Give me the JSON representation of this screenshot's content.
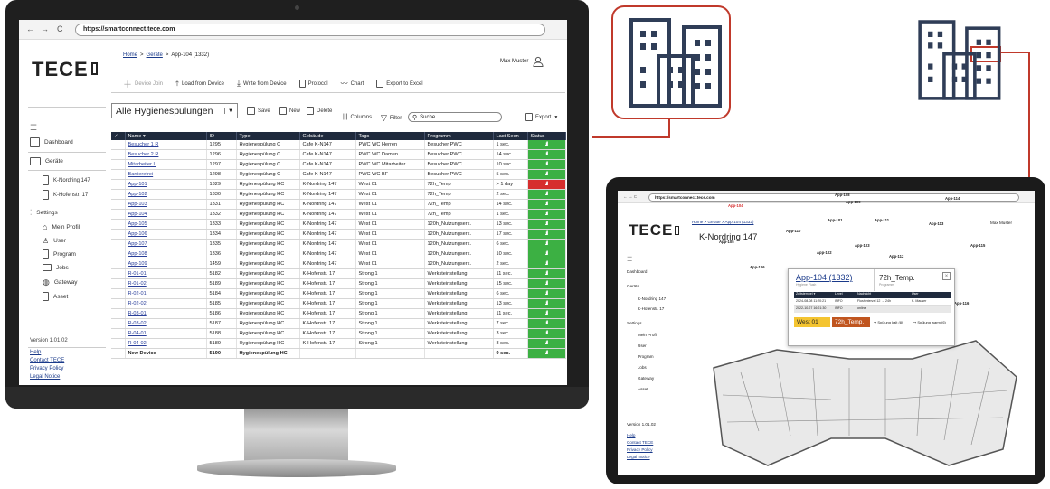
{
  "browser": {
    "url": "https://smartconnect.tece.com",
    "back": "←",
    "forward": "→",
    "reload": "C"
  },
  "brand": {
    "logo": "TECE",
    "accent": "#c0392b",
    "navy": "#1f2a3d",
    "good": "#3cb043",
    "bad": "#d62e2e"
  },
  "breadcrumb": {
    "home": "Home",
    "sep1": ">",
    "devices": "Geräte",
    "sep2": ">",
    "current": "App-104 (1332)"
  },
  "user": {
    "name": "Max Muster"
  },
  "sidebar": {
    "dashboard": "Dashboard",
    "devices": "Geräte",
    "sites": [
      "K-Nordring 147",
      "K-Hofenstr. 17"
    ],
    "settings": "Settings",
    "settings_items": [
      "Mein Profil",
      "User",
      "Program",
      "Jobs",
      "Gateway",
      "Asset"
    ],
    "version": "Version 1.01.02",
    "links": [
      "Help",
      "Contact TECE",
      "Privacy Policy",
      "Legal Notice"
    ]
  },
  "toolbar": {
    "device_join": "Device Join",
    "load": "Load from Device",
    "write": "Write from Device",
    "protocol": "Protocol",
    "chart": "Chart",
    "export_excel": "Export to Excel"
  },
  "view": {
    "title": "Alle Hygienespülungen",
    "save": "Save",
    "new": "New",
    "delete": "Delete",
    "columns": "Columns",
    "filter": "Filter",
    "search_placeholder": "Suche",
    "export": "Export"
  },
  "table": {
    "columns": [
      "✓",
      "Name ▾",
      "ID",
      "Type",
      "Gebäude",
      "Tags",
      "Programm",
      "Last Seen",
      "Status"
    ],
    "rows": [
      {
        "name": "Besucher 1 R",
        "id": "1295",
        "type": "Hygienespülung C",
        "building": "Cafe K-N147",
        "tags": "PWC WC Herren",
        "program": "Besucher PWC",
        "seen": "1 sec.",
        "ok": true
      },
      {
        "name": "Besucher 2 R",
        "id": "1296",
        "type": "Hygienespülung C",
        "building": "Cafe K-N147",
        "tags": "PWC WC Damen",
        "program": "Besucher PWC",
        "seen": "14 sec.",
        "ok": true
      },
      {
        "name": "Mitarbeiter L",
        "id": "1297",
        "type": "Hygienespülung C",
        "building": "Cafe K-N147",
        "tags": "PWC WC Mitarbeiter",
        "program": "Besucher PWC",
        "seen": "10 sec.",
        "ok": true
      },
      {
        "name": "Barrierefrei",
        "id": "1298",
        "type": "Hygienespülung C",
        "building": "Cafe K-N147",
        "tags": "PWC WC BF",
        "program": "Besucher PWC",
        "seen": "5 sec.",
        "ok": true
      },
      {
        "name": "App-101",
        "id": "1329",
        "type": "Hygienespülung HC",
        "building": "K-Nordring 147",
        "tags": "West 01",
        "program": "72h_Temp",
        "seen": "> 1 day",
        "ok": false
      },
      {
        "name": "App-102",
        "id": "1330",
        "type": "Hygienespülung HC",
        "building": "K-Nordring 147",
        "tags": "West 01",
        "program": "72h_Temp",
        "seen": "2 sec.",
        "ok": true
      },
      {
        "name": "App-103",
        "id": "1331",
        "type": "Hygienespülung HC",
        "building": "K-Nordring 147",
        "tags": "West 01",
        "program": "72h_Temp",
        "seen": "14 sec.",
        "ok": true
      },
      {
        "name": "App-104",
        "id": "1332",
        "type": "Hygienespülung HC",
        "building": "K-Nordring 147",
        "tags": "West 01",
        "program": "72h_Temp",
        "seen": "1 sec.",
        "ok": true
      },
      {
        "name": "App-105",
        "id": "1333",
        "type": "Hygienespülung HC",
        "building": "K-Nordring 147",
        "tags": "West 01",
        "program": "120h_Nutzungserk.",
        "seen": "13 sec.",
        "ok": true
      },
      {
        "name": "App-106",
        "id": "1334",
        "type": "Hygienespülung HC",
        "building": "K-Nordring 147",
        "tags": "West 01",
        "program": "120h_Nutzungserk.",
        "seen": "17 sec.",
        "ok": true
      },
      {
        "name": "App-107",
        "id": "1335",
        "type": "Hygienespülung HC",
        "building": "K-Nordring 147",
        "tags": "West 01",
        "program": "120h_Nutzungserk.",
        "seen": "6 sec.",
        "ok": true
      },
      {
        "name": "App-108",
        "id": "1336",
        "type": "Hygienespülung HC",
        "building": "K-Nordring 147",
        "tags": "West 01",
        "program": "120h_Nutzungserk.",
        "seen": "10 sec.",
        "ok": true
      },
      {
        "name": "App-109",
        "id": "1459",
        "type": "Hygienespülung HC",
        "building": "K-Nordring 147",
        "tags": "West 01",
        "program": "120h_Nutzungserk.",
        "seen": "2 sec.",
        "ok": true
      },
      {
        "name": "R-01-01",
        "id": "5182",
        "type": "Hygienespülung HC",
        "building": "K-Hofenstr. 17",
        "tags": "Strong 1",
        "program": "Werksteinstellung",
        "seen": "11 sec.",
        "ok": true
      },
      {
        "name": "R-01-02",
        "id": "5189",
        "type": "Hygienespülung HC",
        "building": "K-Hofenstr. 17",
        "tags": "Strong 1",
        "program": "Werksteinstellung",
        "seen": "15 sec.",
        "ok": true
      },
      {
        "name": "R-02-01",
        "id": "5184",
        "type": "Hygienespülung HC",
        "building": "K-Hofenstr. 17",
        "tags": "Strong 1",
        "program": "Werksteinstellung",
        "seen": "6 sec.",
        "ok": true
      },
      {
        "name": "R-02-02",
        "id": "5185",
        "type": "Hygienespülung HC",
        "building": "K-Hofenstr. 17",
        "tags": "Strong 1",
        "program": "Werksteinstellung",
        "seen": "13 sec.",
        "ok": true
      },
      {
        "name": "R-03-01",
        "id": "5186",
        "type": "Hygienespülung HC",
        "building": "K-Hofenstr. 17",
        "tags": "Strong 1",
        "program": "Werksteinstellung",
        "seen": "11 sec.",
        "ok": true
      },
      {
        "name": "R-03-02",
        "id": "5187",
        "type": "Hygienespülung HC",
        "building": "K-Hofenstr. 17",
        "tags": "Strong 1",
        "program": "Werksteinstellung",
        "seen": "7 sec.",
        "ok": true
      },
      {
        "name": "R-04-01",
        "id": "5188",
        "type": "Hygienespülung HC",
        "building": "K-Hofenstr. 17",
        "tags": "Strong 1",
        "program": "Werksteinstellung",
        "seen": "3 sec.",
        "ok": true
      },
      {
        "name": "R-04-02",
        "id": "5189",
        "type": "Hygienespülung HC",
        "building": "K-Hofenstr. 17",
        "tags": "Strong 1",
        "program": "Werksteinstellung",
        "seen": "8 sec.",
        "ok": true
      },
      {
        "name": "New Device",
        "id": "5190",
        "type": "Hygienespülung HC",
        "building": "",
        "tags": "",
        "program": "",
        "seen": "9 sec.",
        "ok": true,
        "bold": true
      }
    ]
  },
  "tablet": {
    "url": "https://smartconnect.tece.com",
    "breadcrumb": "Home > Geräte > App-104 (1332)",
    "user": "Max Muster",
    "title": "K-Nordring 147",
    "popup": {
      "device": "App-104 (1332)",
      "device_sub": "Hygiene Flush",
      "program": "72h_Temp.",
      "program_sub": "Programm",
      "columns": [
        "Zeitstempel ▾",
        "Level",
        "Nachricht",
        "User"
      ],
      "rows": [
        [
          "2024-08-08  11:20:21",
          "INFO",
          "Flushinterval 12 → 24h",
          "K. Mauser"
        ],
        [
          "2022-10-27  16:21:30",
          "INFO",
          "online",
          ""
        ]
      ],
      "tag": "West 01",
      "prog_tag": "72h_Temp.",
      "flush_cold": "Spülung kalt (8)",
      "flush_warm": "Spülung warm (6)"
    },
    "apps": [
      "App-104",
      "App-105",
      "App-106",
      "App-107",
      "App-108",
      "App-109",
      "App-101",
      "App-102",
      "App-103",
      "App-111",
      "App-112",
      "App-113",
      "App-114",
      "App-115",
      "App-116",
      "App-110"
    ]
  }
}
